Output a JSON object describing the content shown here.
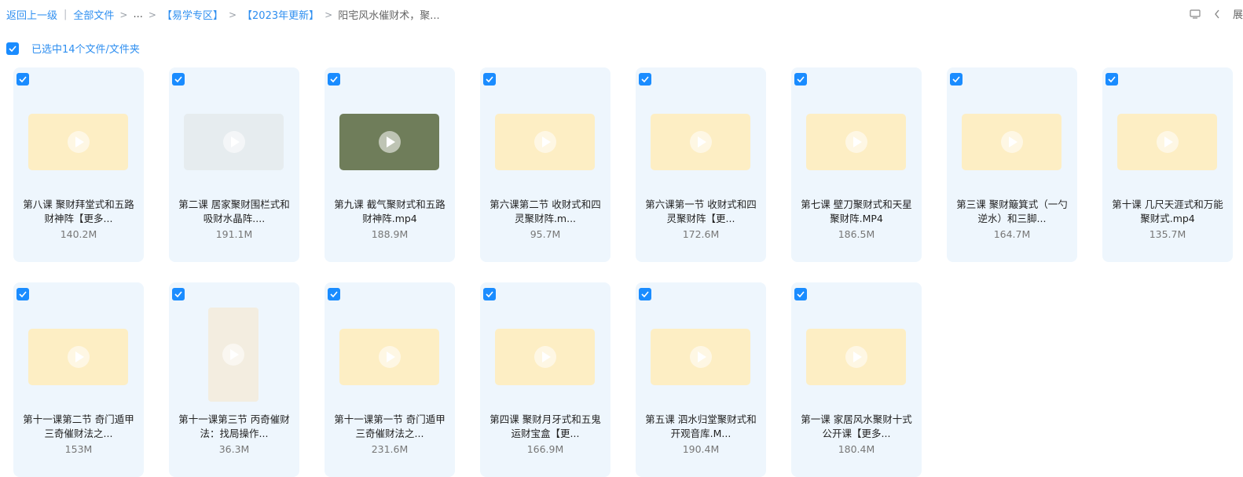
{
  "breadcrumb": {
    "back": "返回上一级",
    "all_files": "全部文件",
    "ellipsis": "...",
    "folder1": "【易学专区】",
    "folder2": "【2023年更新】",
    "current": "阳宅风水催财术，聚..."
  },
  "toolbar": {
    "expand_label": "展"
  },
  "selection": {
    "text": "已选中14个文件/文件夹"
  },
  "colors": {
    "accent": "#1a8cff",
    "card_bg": "#eef6fd",
    "thumb_bg": "#fdeec4"
  },
  "files": [
    {
      "name": "第八课 聚财拜堂式和五路财神阵【更多...",
      "size": "140.2M",
      "thumb": "slide"
    },
    {
      "name": "第二课 居家聚财围栏式和吸财水晶阵....",
      "size": "191.1M",
      "thumb": "map"
    },
    {
      "name": "第九课 截气聚财式和五路财神阵.mp4",
      "size": "188.9M",
      "thumb": "aerial"
    },
    {
      "name": "第六课第二节 收财式和四灵聚财阵.m...",
      "size": "95.7M",
      "thumb": "slide"
    },
    {
      "name": "第六课第一节 收财式和四灵聚财阵【更...",
      "size": "172.6M",
      "thumb": "slide"
    },
    {
      "name": "第七课 壁刀聚财式和天星聚财阵.MP4",
      "size": "186.5M",
      "thumb": "diagram"
    },
    {
      "name": "第三课 聚财簸箕式（一勺逆水）和三脚...",
      "size": "164.7M",
      "thumb": "diagram"
    },
    {
      "name": "第十课 几尺天涯式和万能聚财式.mp4",
      "size": "135.7M",
      "thumb": "slide"
    },
    {
      "name": "第十一课第二节 奇门遁甲三奇催财法之...",
      "size": "153M",
      "thumb": "slide"
    },
    {
      "name": "第十一课第三节 丙奇催财法：找局操作...",
      "size": "36.3M",
      "thumb": "phone"
    },
    {
      "name": "第十一课第一节 奇门遁甲三奇催财法之...",
      "size": "231.6M",
      "thumb": "slide"
    },
    {
      "name": "第四课 聚财月牙式和五鬼运财宝盒【更...",
      "size": "166.9M",
      "thumb": "slide"
    },
    {
      "name": "第五课 泗水归堂聚财式和开观音库.M...",
      "size": "190.4M",
      "thumb": "slide"
    },
    {
      "name": "第一课 家居风水聚财十式公开课【更多...",
      "size": "180.4M",
      "thumb": "photo"
    }
  ]
}
